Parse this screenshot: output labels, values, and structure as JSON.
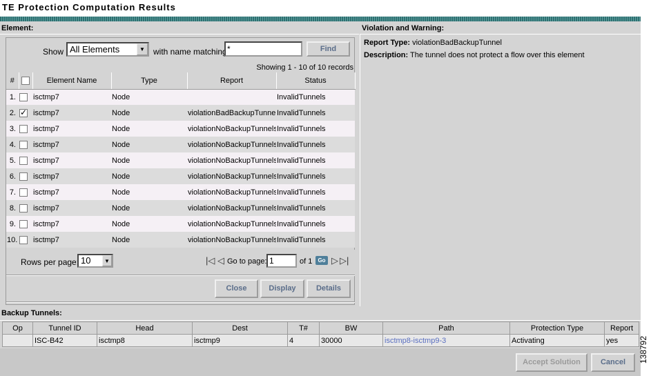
{
  "page": {
    "title": "TE Protection Computation Results",
    "figure_id": "138792"
  },
  "element": {
    "section_label": "Element:",
    "show_label": "Show",
    "show_value": "All Elements",
    "match_label": "with name matching",
    "match_value": "*",
    "find_label": "Find",
    "showing_text": "Showing 1 - 10 of 10 records",
    "columns": [
      "#",
      "Element Name",
      "Type",
      "Report",
      "Status"
    ],
    "rows": [
      {
        "num": "1.",
        "checked": false,
        "name": "isctmp7",
        "type": "Node",
        "report": "",
        "status": "InvalidTunnels"
      },
      {
        "num": "2.",
        "checked": true,
        "name": "isctmp7",
        "type": "Node",
        "report": "violationBadBackupTunnel",
        "status": "InvalidTunnels"
      },
      {
        "num": "3.",
        "checked": false,
        "name": "isctmp7",
        "type": "Node",
        "report": "violationNoBackupTunnels",
        "status": "InvalidTunnels"
      },
      {
        "num": "4.",
        "checked": false,
        "name": "isctmp7",
        "type": "Node",
        "report": "violationNoBackupTunnels",
        "status": "InvalidTunnels"
      },
      {
        "num": "5.",
        "checked": false,
        "name": "isctmp7",
        "type": "Node",
        "report": "violationNoBackupTunnels",
        "status": "InvalidTunnels"
      },
      {
        "num": "6.",
        "checked": false,
        "name": "isctmp7",
        "type": "Node",
        "report": "violationNoBackupTunnels",
        "status": "InvalidTunnels"
      },
      {
        "num": "7.",
        "checked": false,
        "name": "isctmp7",
        "type": "Node",
        "report": "violationNoBackupTunnels",
        "status": "InvalidTunnels"
      },
      {
        "num": "8.",
        "checked": false,
        "name": "isctmp7",
        "type": "Node",
        "report": "violationNoBackupTunnels",
        "status": "InvalidTunnels"
      },
      {
        "num": "9.",
        "checked": false,
        "name": "isctmp7",
        "type": "Node",
        "report": "violationNoBackupTunnels",
        "status": "InvalidTunnels"
      },
      {
        "num": "10.",
        "checked": false,
        "name": "isctmp7",
        "type": "Node",
        "report": "violationNoBackupTunnels",
        "status": "InvalidTunnels"
      }
    ],
    "rows_per_page_label": "Rows per page:",
    "rows_per_page_value": "10",
    "goto_label": "Go to page:",
    "page_value": "1",
    "of_label": "of 1",
    "go_label": "Go",
    "close_label": "Close",
    "display_label": "Display",
    "details_label": "Details"
  },
  "violation": {
    "section_label": "Violation and Warning:",
    "report_type_label": "Report Type:",
    "report_type_value": "violationBadBackupTunnel",
    "description_label": "Description:",
    "description_value": "The tunnel does not protect a flow over this element"
  },
  "backup": {
    "section_label": "Backup Tunnels:",
    "columns": [
      "Op",
      "Tunnel ID",
      "Head",
      "Dest",
      "T#",
      "BW",
      "Path",
      "Protection Type",
      "Report"
    ],
    "rows": [
      {
        "op": "",
        "tunnel_id": "ISC-B42",
        "head": "isctmp8",
        "dest": "isctmp9",
        "t": "4",
        "bw": "30000",
        "path": "isctmp8-isctmp9-3",
        "protection": "Activating",
        "report": "yes"
      }
    ]
  },
  "footer": {
    "accept_label": "Accept Solution",
    "cancel_label": "Cancel"
  },
  "colors": {
    "stripe": "#2f6f70",
    "panel": "#d4d4d4",
    "button_text": "#5a6d8a",
    "link": "#5a6fc0"
  }
}
